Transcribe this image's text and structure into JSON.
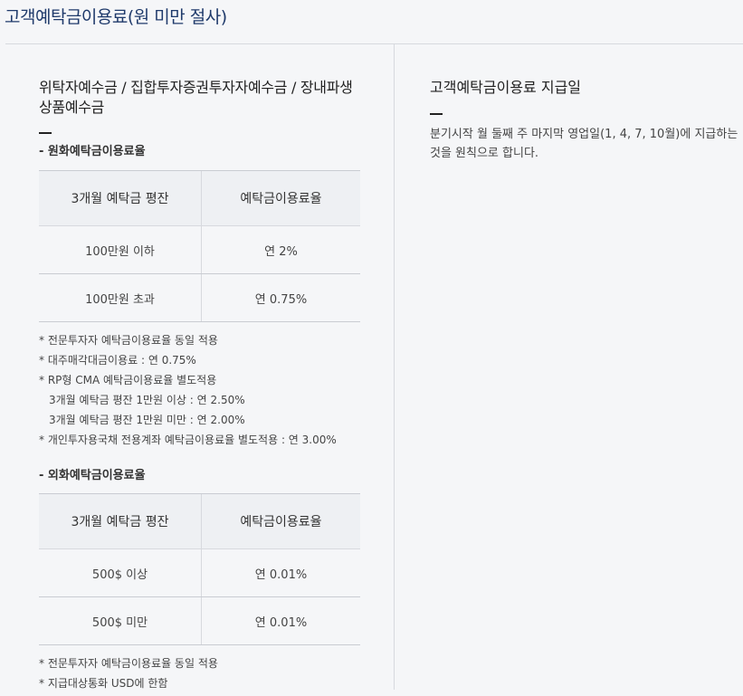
{
  "page_title": "고객예탁금이용료(원 미만 절사)",
  "left": {
    "title": "위탁자예수금 / 집합투자증권투자자예수금 / 장내파생상품예수금",
    "krw": {
      "subtitle": "- 원화예탁금이용료율",
      "headers": [
        "3개월 예탁금 평잔",
        "예탁금이용료율"
      ],
      "rows": [
        [
          "100만원 이하",
          "연 2%"
        ],
        [
          "100만원 초과",
          "연 0.75%"
        ]
      ],
      "notes": [
        "* 전문투자자 예탁금이용료율 동일 적용",
        "* 대주매각대금이용료 : 연 0.75%",
        "* RP형 CMA 예탁금이용료율 별도적용",
        "3개월 예탁금 평잔 1만원 이상 : 연 2.50%",
        "3개월 예탁금 평잔 1만원 미만 : 연 2.00%",
        "* 개인투자용국채 전용계좌 예탁금이용료율 별도적용 : 연 3.00%"
      ]
    },
    "fx": {
      "subtitle": "- 외화예탁금이용료율",
      "headers": [
        "3개월 예탁금 평잔",
        "예탁금이용료율"
      ],
      "rows": [
        [
          "500$ 이상",
          "연 0.01%"
        ],
        [
          "500$ 미만",
          "연 0.01%"
        ]
      ],
      "notes": [
        "* 전문투자자 예탁금이용료율 동일 적용",
        "* 지급대상통화 USD에 한함"
      ]
    }
  },
  "right": {
    "title": "고객예탁금이용료 지급일",
    "text": "분기시작 월 둘째 주 마지막 영업일(1, 4, 7, 10월)에 지급하는 것을 원칙으로 합니다."
  }
}
